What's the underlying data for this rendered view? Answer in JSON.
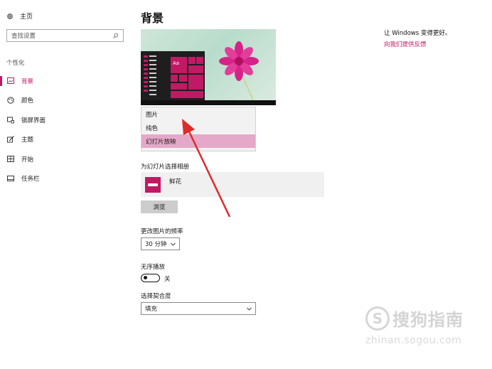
{
  "sidebar": {
    "home_label": "主页",
    "search_placeholder": "查找设置",
    "section_label": "个性化",
    "items": [
      {
        "label": "背景",
        "icon": "picture-icon",
        "active": true
      },
      {
        "label": "颜色",
        "icon": "palette-icon"
      },
      {
        "label": "锁屏界面",
        "icon": "lock-screen-icon"
      },
      {
        "label": "主题",
        "icon": "brush-icon"
      },
      {
        "label": "开始",
        "icon": "start-grid-icon"
      },
      {
        "label": "任务栏",
        "icon": "taskbar-icon"
      }
    ]
  },
  "main": {
    "title": "背景",
    "preview": {
      "tile_text": "Aa"
    },
    "background_options": [
      "图片",
      "纯色",
      "幻灯片放映"
    ],
    "selected_option": "幻灯片放映",
    "album_label": "为幻灯片选择相册",
    "album_name": "鲜花",
    "browse_label": "浏览",
    "freq_label": "更改图片的频率",
    "freq_value": "30 分钟",
    "shuffle_label": "无序播放",
    "shuffle_state": "关",
    "fit_label": "选择契合度",
    "fit_value": "填充"
  },
  "right_panel": {
    "title": "让 Windows 变得更好。",
    "link": "向我们提供反馈"
  },
  "watermark": {
    "text": "搜狗指南",
    "url": "zhinan.sogou.com"
  },
  "colors": {
    "accent": "#c01a64",
    "selected_bg": "#e6a8c8",
    "arrow": "#e02a2a"
  }
}
